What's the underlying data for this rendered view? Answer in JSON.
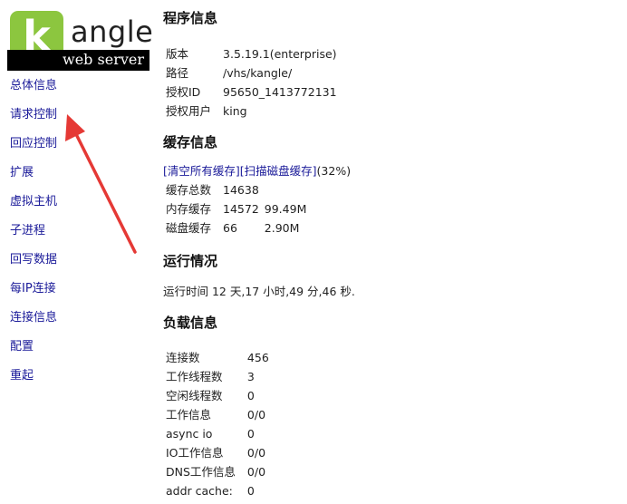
{
  "logo": {
    "mark": "k",
    "word": "angle",
    "tagline": "web server"
  },
  "sidebar": {
    "items": [
      {
        "label": "总体信息"
      },
      {
        "label": "请求控制"
      },
      {
        "label": "回应控制"
      },
      {
        "label": "扩展"
      },
      {
        "label": "虚拟主机"
      },
      {
        "label": "子进程"
      },
      {
        "label": "回写数据"
      },
      {
        "label": "每IP连接"
      },
      {
        "label": "连接信息"
      },
      {
        "label": "配置"
      },
      {
        "label": "重起"
      }
    ]
  },
  "annotation": {
    "color": "#e53935"
  },
  "program": {
    "title": "程序信息",
    "rows": [
      {
        "k": "版本",
        "v": "3.5.19.1(enterprise)"
      },
      {
        "k": "路径",
        "v": "/vhs/kangle/"
      },
      {
        "k": "授权ID",
        "v": "95650_1413772131"
      },
      {
        "k": "授权用户",
        "v": "king"
      }
    ]
  },
  "cache": {
    "title": "缓存信息",
    "link_clear": "[清空所有缓存]",
    "link_scan": "[扫描磁盘缓存]",
    "percent": "(32%)",
    "rows": [
      {
        "k": "缓存总数",
        "v": "14638",
        "v2": ""
      },
      {
        "k": "内存缓存",
        "v": "14572",
        "v2": "99.49M"
      },
      {
        "k": "磁盘缓存",
        "v": "66",
        "v2": "2.90M"
      }
    ]
  },
  "running": {
    "title": "运行情况",
    "text": "运行时间 12 天,17 小时,49 分,46 秒."
  },
  "load": {
    "title": "负载信息",
    "rows": [
      {
        "k": "连接数",
        "v": "456"
      },
      {
        "k": "工作线程数",
        "v": "3"
      },
      {
        "k": "空闲线程数",
        "v": "0"
      },
      {
        "k": "工作信息",
        "v": "0/0"
      },
      {
        "k": "async io",
        "v": "0"
      },
      {
        "k": "IO工作信息",
        "v": "0/0"
      },
      {
        "k": "DNS工作信息",
        "v": "0/0"
      },
      {
        "k": "addr cache:",
        "v": "0"
      }
    ]
  }
}
